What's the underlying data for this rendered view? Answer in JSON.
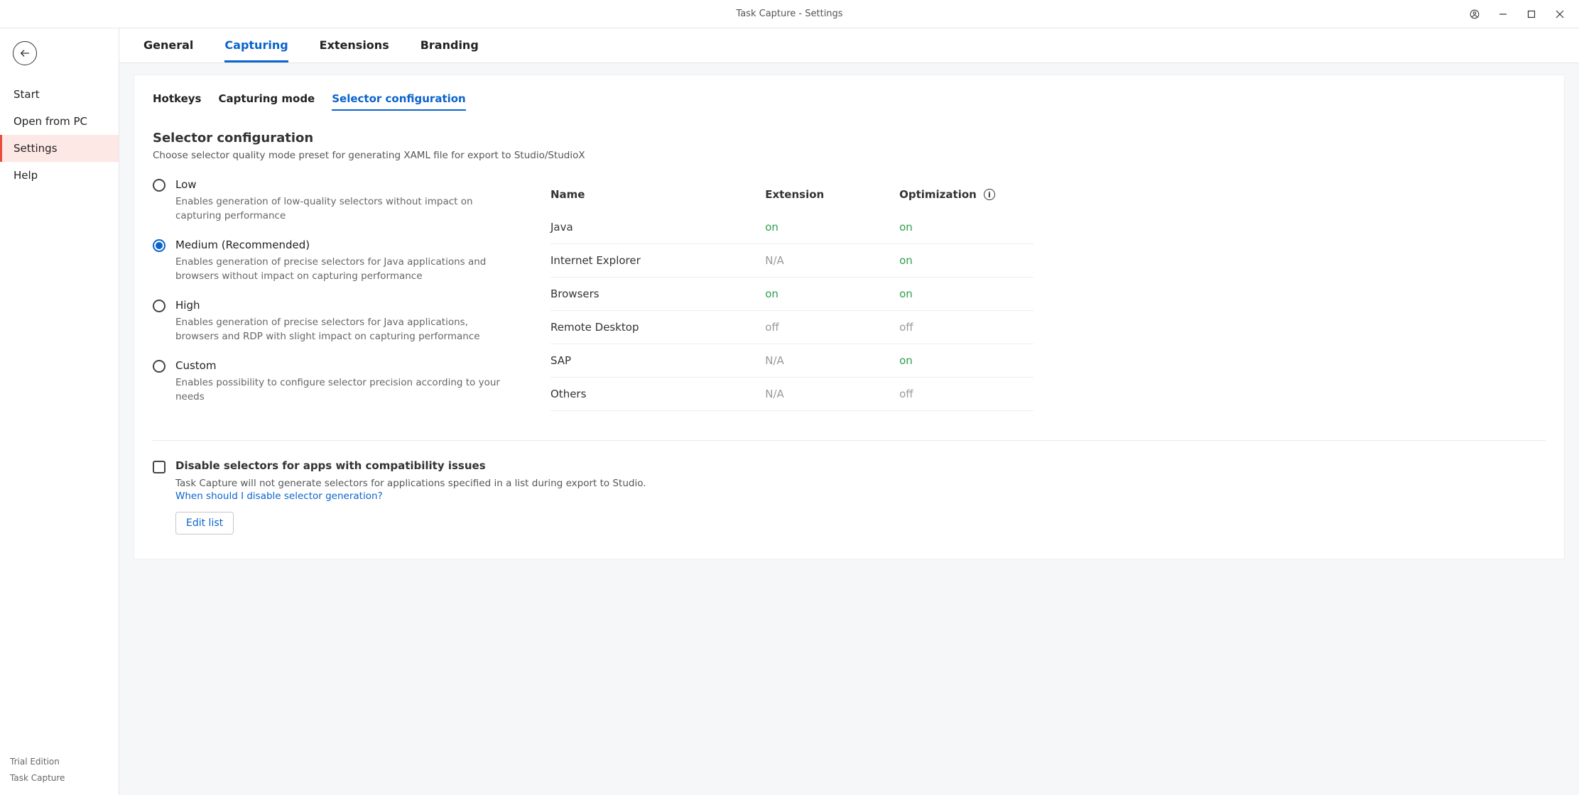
{
  "window_title": "Task Capture - Settings",
  "sidebar": {
    "items": [
      {
        "label": "Start"
      },
      {
        "label": "Open from PC"
      },
      {
        "label": "Settings"
      },
      {
        "label": "Help"
      }
    ],
    "footer_edition": "Trial Edition",
    "footer_product": "Task Capture"
  },
  "tabs": [
    {
      "label": "General"
    },
    {
      "label": "Capturing"
    },
    {
      "label": "Extensions"
    },
    {
      "label": "Branding"
    }
  ],
  "subtabs": [
    {
      "label": "Hotkeys"
    },
    {
      "label": "Capturing mode"
    },
    {
      "label": "Selector configuration"
    }
  ],
  "section": {
    "title": "Selector configuration",
    "desc": "Choose selector quality mode preset for generating XAML file for export to Studio/StudioX"
  },
  "radio_options": [
    {
      "label": "Low",
      "desc": "Enables generation of low-quality selectors without impact on capturing performance"
    },
    {
      "label": "Medium (Recommended)",
      "desc": "Enables generation of precise selectors for Java applications and browsers without impact on capturing performance"
    },
    {
      "label": "High",
      "desc": "Enables generation of precise selectors for Java applications, browsers and RDP with slight impact on capturing performance"
    },
    {
      "label": "Custom",
      "desc": "Enables possibility to configure selector precision according to your needs"
    }
  ],
  "ext_table": {
    "headers": {
      "name": "Name",
      "extension": "Extension",
      "optimization": "Optimization"
    },
    "rows": [
      {
        "name": "Java",
        "extension": "on",
        "ext_cls": "val-on",
        "optimization": "on",
        "opt_cls": "val-on"
      },
      {
        "name": "Internet Explorer",
        "extension": "N/A",
        "ext_cls": "val-na",
        "optimization": "on",
        "opt_cls": "val-on"
      },
      {
        "name": "Browsers",
        "extension": "on",
        "ext_cls": "val-on",
        "optimization": "on",
        "opt_cls": "val-on"
      },
      {
        "name": "Remote Desktop",
        "extension": "off",
        "ext_cls": "val-off",
        "optimization": "off",
        "opt_cls": "val-off"
      },
      {
        "name": "SAP",
        "extension": "N/A",
        "ext_cls": "val-na",
        "optimization": "on",
        "opt_cls": "val-on"
      },
      {
        "name": "Others",
        "extension": "N/A",
        "ext_cls": "val-na",
        "optimization": "off",
        "opt_cls": "val-off"
      }
    ]
  },
  "compat": {
    "title": "Disable selectors for apps with compatibility issues",
    "desc": "Task Capture will not generate selectors for applications specified in a list during export to Studio.",
    "link": "When should I disable selector generation?",
    "button": "Edit list"
  }
}
